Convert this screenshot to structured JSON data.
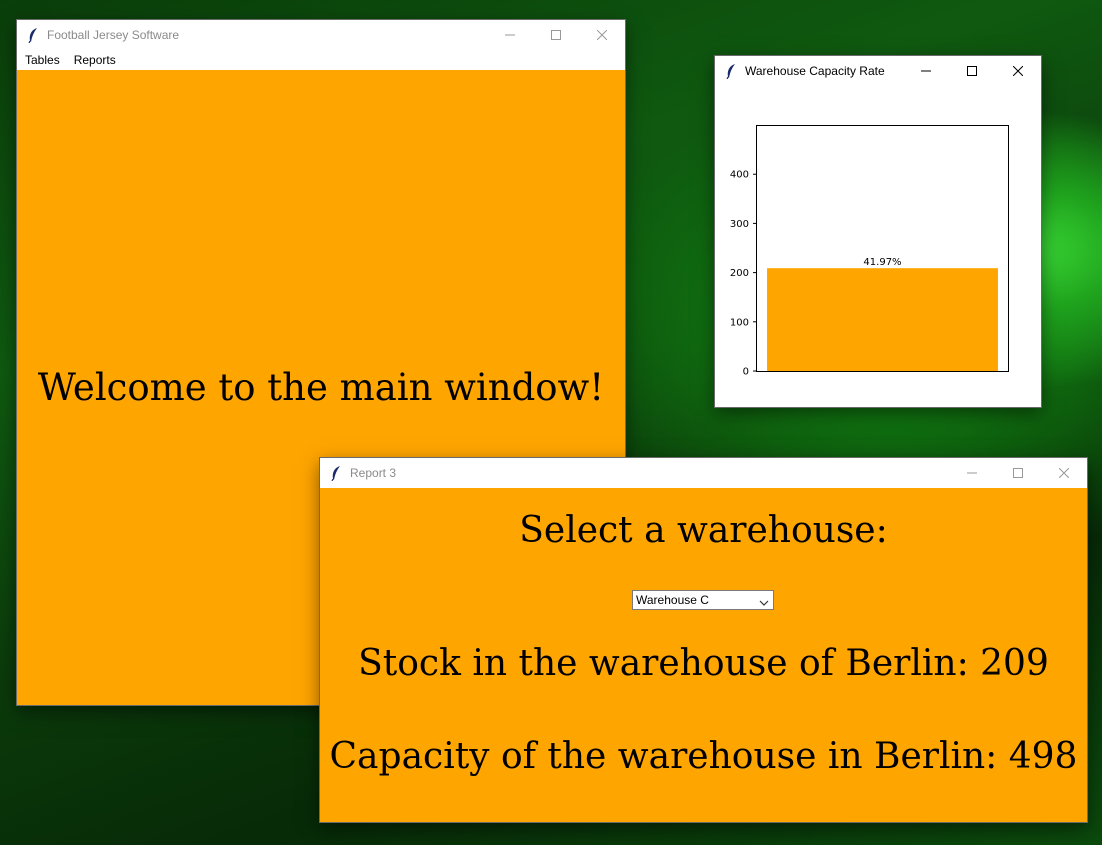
{
  "main_window": {
    "title": "Football Jersey Software",
    "menu": [
      "Tables",
      "Reports"
    ],
    "welcome_text": "Welcome to the main window!"
  },
  "chart_window": {
    "title": "Warehouse Capacity Rate",
    "chart_data": {
      "type": "bar",
      "categories": [
        ""
      ],
      "values": [
        209
      ],
      "data_labels": [
        "41.97%"
      ],
      "ylim": [
        0,
        498
      ],
      "yticks": [
        0,
        100,
        200,
        300,
        400
      ],
      "bar_color": "#ffa500"
    }
  },
  "report_window": {
    "title": "Report 3",
    "heading": "Select a warehouse:",
    "select": {
      "selected": "Warehouse C"
    },
    "stock_text": "Stock in the warehouse of Berlin: 209",
    "capacity_text": "Capacity of the warehouse in Berlin: 498"
  },
  "colors": {
    "accent": "#ffa500"
  }
}
